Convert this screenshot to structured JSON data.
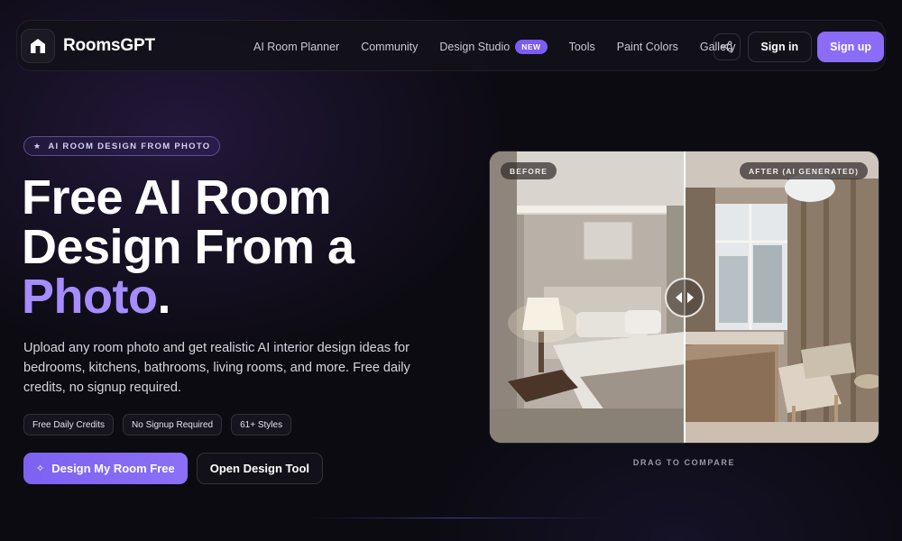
{
  "nav": {
    "brand": "RoomsGPT",
    "links": [
      {
        "label": "AI Room Planner"
      },
      {
        "label": "Community"
      },
      {
        "label": "Design Studio",
        "badge": "NEW"
      },
      {
        "label": "Tools"
      },
      {
        "label": "Paint Colors"
      },
      {
        "label": "Gallery"
      }
    ],
    "share_icon": "share-icon",
    "sign_in": "Sign in",
    "sign_up": "Sign up"
  },
  "hero": {
    "eyebrow": "AI ROOM DESIGN FROM PHOTO",
    "headline_line1": "Free AI Room",
    "headline_line2": "Design From a",
    "headline_accent": "Photo",
    "headline_end": ".",
    "subtext": "Upload any room photo and get realistic AI interior design ideas for bedrooms, kitchens, bathrooms, living rooms, and more. Free daily credits, no signup required.",
    "chips": [
      "Free Daily Credits",
      "No Signup Required",
      "61+ Styles"
    ],
    "cta_primary": "Design My Room Free",
    "cta_secondary": "Open Design Tool"
  },
  "compare": {
    "before_label": "BEFORE",
    "after_label": "AFTER (AI GENERATED)",
    "drag_hint": "DRAG TO COMPARE"
  },
  "colors": {
    "accent": "#8a6cf7",
    "accent_text": "#a58cff",
    "background": "#0c0b12"
  }
}
